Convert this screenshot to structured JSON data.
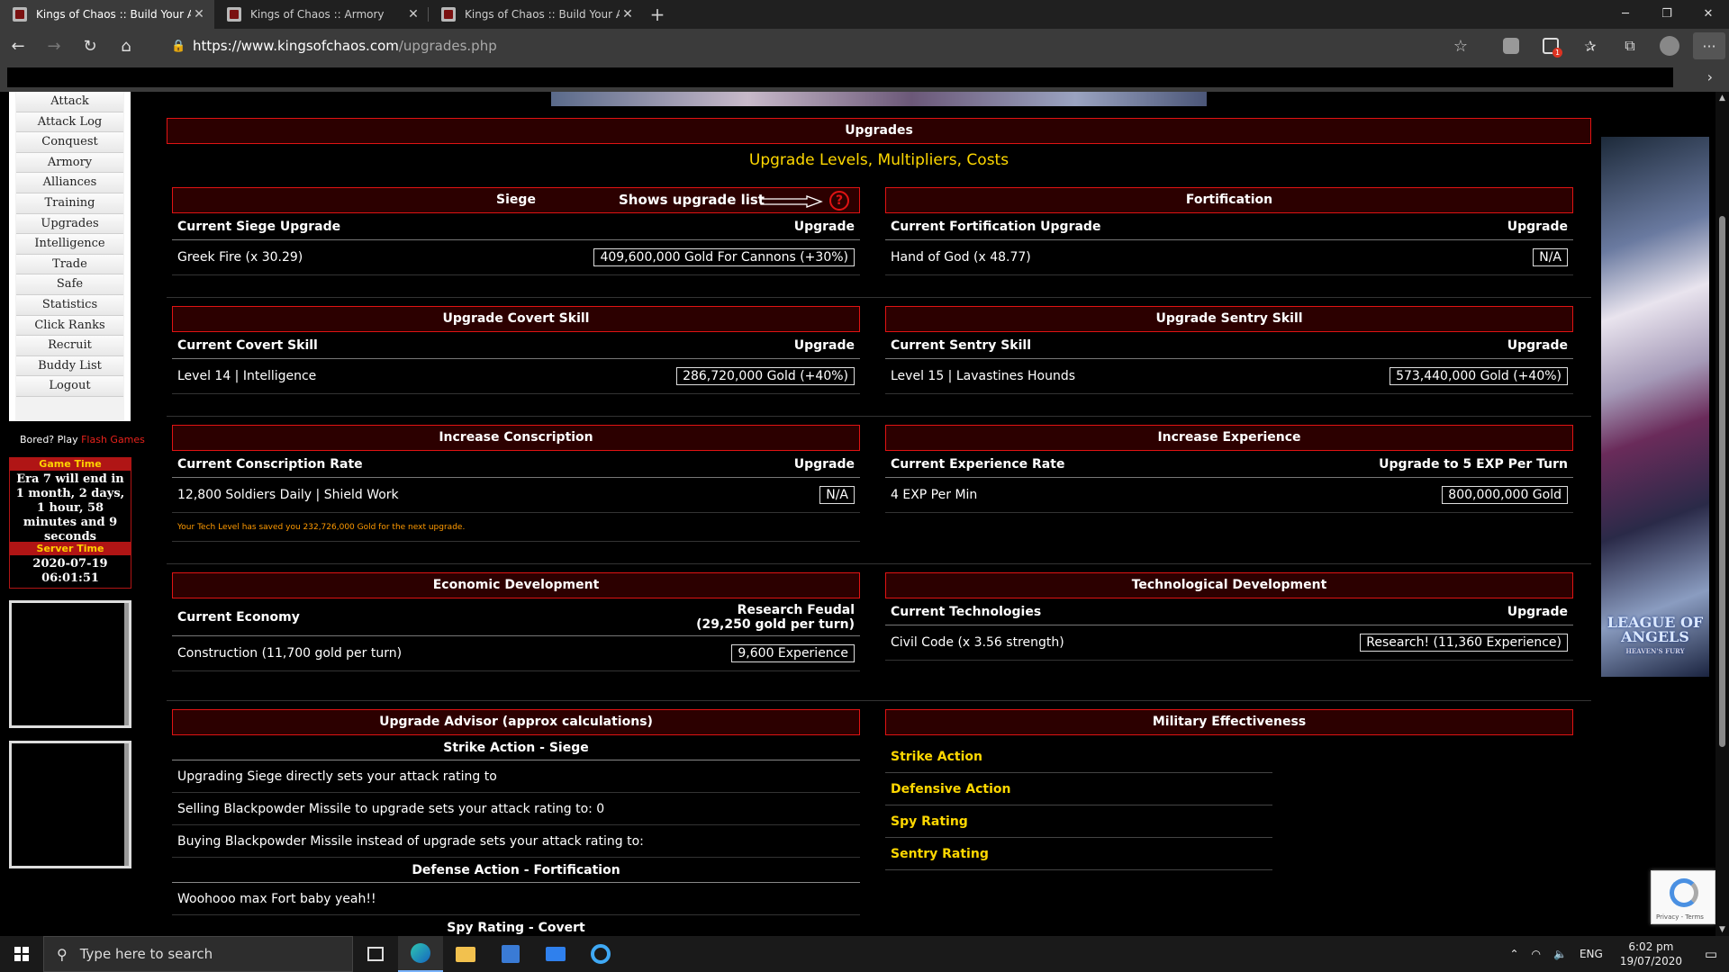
{
  "browser": {
    "tabs": [
      {
        "title": "Kings of Chaos :: Build Your Army",
        "active": true
      },
      {
        "title": "Kings of Chaos :: Armory",
        "active": false
      },
      {
        "title": "Kings of Chaos :: Build Your Army",
        "active": false
      }
    ],
    "url_host": "https://www.kingsofchaos.com",
    "url_path": "/upgrades.php",
    "ext_badge": "1"
  },
  "sidebar": {
    "items": [
      "Attack",
      "Attack Log",
      "Conquest",
      "Armory",
      "Alliances",
      "Training",
      "Upgrades",
      "Intelligence",
      "Trade",
      "Safe",
      "Statistics",
      "Click Ranks",
      "Recruit",
      "Buddy List",
      "Logout"
    ],
    "bored_text": "Bored? Play",
    "bored_link": "Flash Games",
    "game_time_title": "Game Time",
    "game_time_text": "Era 7 will end in 1 month, 2 days, 1 hour, 58 minutes and 9 seconds",
    "server_time_title": "Server Time",
    "server_date": "2020-07-19",
    "server_clock": "06:01:51"
  },
  "main": {
    "title": "Upgrades",
    "subtitle": "Upgrade Levels, Multipliers, Costs",
    "hint": "Shows upgrade list",
    "siege": {
      "title": "Siege",
      "col1": "Current Siege Upgrade",
      "col2": "Upgrade",
      "value": "Greek Fire (x 30.29)",
      "button": "409,600,000 Gold For Cannons (+30%)"
    },
    "fortification": {
      "title": "Fortification",
      "col1": "Current Fortification Upgrade",
      "col2": "Upgrade",
      "value": "Hand of God (x 48.77)",
      "button": "N/A"
    },
    "covert": {
      "title": "Upgrade Covert Skill",
      "col1": "Current Covert Skill",
      "col2": "Upgrade",
      "value": "Level 14 | Intelligence",
      "button": "286,720,000 Gold (+40%)"
    },
    "sentry": {
      "title": "Upgrade Sentry Skill",
      "col1": "Current Sentry Skill",
      "col2": "Upgrade",
      "value": "Level 15 | Lavastines Hounds",
      "button": "573,440,000 Gold (+40%)"
    },
    "conscription": {
      "title": "Increase Conscription",
      "col1": "Current Conscription Rate",
      "col2": "Upgrade",
      "value": "12,800 Soldiers Daily | Shield Work",
      "button": "N/A",
      "note": "Your Tech Level has saved you 232,726,000 Gold for the next upgrade."
    },
    "experience": {
      "title": "Increase Experience",
      "col1": "Current Experience Rate",
      "col2": "Upgrade to 5 EXP Per Turn",
      "value": "4 EXP Per Min",
      "button": "800,000,000 Gold"
    },
    "economy": {
      "title": "Economic Development",
      "col1": "Current Economy",
      "col2_line1": "Research Feudal",
      "col2_line2": "(29,250 gold per turn)",
      "value": "Construction (11,700 gold per turn)",
      "button": "9,600 Experience"
    },
    "technology": {
      "title": "Technological Development",
      "col1": "Current Technologies",
      "col2": "Upgrade",
      "value": "Civil Code (x 3.56 strength)",
      "button": "Research! (11,360 Experience)"
    },
    "advisor": {
      "title": "Upgrade Advisor (approx calculations)",
      "strike_title": "Strike Action - Siege",
      "strike_rows": [
        "Upgrading Siege directly sets your attack rating to",
        "Selling Blackpowder Missile to upgrade sets your attack rating to: 0",
        "Buying Blackpowder Missile instead of upgrade sets your attack rating to:"
      ],
      "defense_title": "Defense Action - Fortification",
      "defense_rows": [
        "Woohooo max Fort baby yeah!!"
      ],
      "spy_title": "Spy Rating - Covert"
    },
    "military": {
      "title": "Military Effectiveness",
      "rows": [
        "Strike Action",
        "Defensive Action",
        "Spy Rating",
        "Sentry Rating"
      ]
    }
  },
  "right_ad": {
    "logo": "LEAGUE OF ANGELS",
    "sub": "HEAVEN'S FURY"
  },
  "recaptcha": {
    "text": "Privacy - Terms"
  },
  "taskbar": {
    "search_placeholder": "Type here to search",
    "lang": "ENG",
    "time": "6:02 pm",
    "date": "19/07/2020"
  }
}
